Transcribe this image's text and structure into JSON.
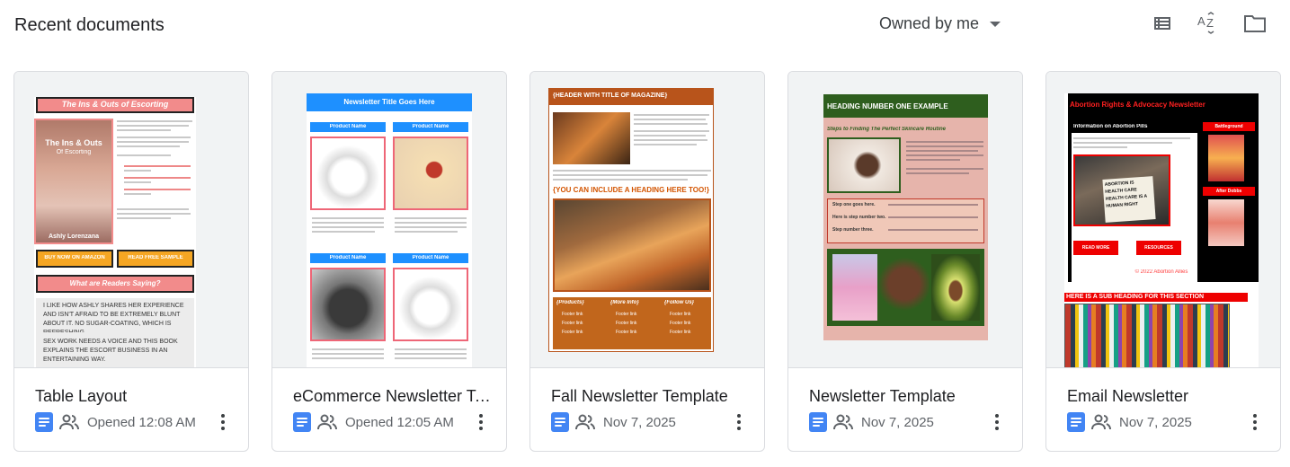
{
  "header": {
    "title": "Recent documents",
    "owner_filter": "Owned by me"
  },
  "toolbar": {
    "list_view_icon": "list-view-icon",
    "sort_icon": "sort-az-icon",
    "folder_icon": "folder-icon"
  },
  "colors": {
    "doc_blue": "#4285f4",
    "border": "#dadce0",
    "meta_gray": "#5f6368"
  },
  "documents": [
    {
      "title": "Table Layout",
      "meta": "Opened 12:08 AM",
      "thumb": {
        "title": "The Ins & Outs of Escorting",
        "book_title": "The Ins & Outs",
        "book_subtitle": "Of Escorting",
        "author": "Ashly Lorenzana",
        "btn1": "BUY NOW ON AMAZON",
        "btn2": "READ FREE SAMPLE",
        "section": "What are Readers Saying?",
        "quote1": "I LIKE HOW ASHLY SHARES HER EXPERIENCE AND ISN'T AFRAID TO BE EXTREMELY BLUNT ABOUT IT. NO SUGAR-COATING, WHICH IS REFRESHING.",
        "quote2": "SEX WORK NEEDS A VOICE AND THIS BOOK EXPLAINS THE ESCORT BUSINESS IN AN ENTERTAINING WAY."
      }
    },
    {
      "title": "eCommerce Newsletter Template",
      "meta": "Opened 12:05 AM",
      "thumb": {
        "title": "Newsletter Title Goes Here",
        "product_label": "Product Name"
      }
    },
    {
      "title": "Fall Newsletter Template",
      "meta": "Nov 7, 2025",
      "thumb": {
        "title": "{HEADER WITH TITLE OF MAGAZINE}",
        "subheading": "{YOU CAN INCLUDE A HEADING HERE TOO!}",
        "footer_cols": [
          "{Products}",
          "{More Info}",
          "{Follow Us}"
        ],
        "footer_link": "Footer link"
      }
    },
    {
      "title": "Newsletter Template",
      "meta": "Nov 7, 2025",
      "thumb": {
        "title": "HEADING NUMBER ONE EXAMPLE",
        "subheading": "Steps to Finding The Perfect Skincare Routine",
        "steps": [
          "Step one goes here.",
          "Here is step number two.",
          "Step number three."
        ]
      }
    },
    {
      "title": "Email Newsletter",
      "meta": "Nov 7, 2025",
      "thumb": {
        "title": "Abortion Rights & Advocacy Newsletter",
        "section": "Information on Abortion Pills",
        "side1": "Battleground",
        "side2": "After Dobbs",
        "sign_text": "ABORTION IS HEALTH CARE HEALTH CARE IS A HUMAN RIGHT",
        "btn1": "READ MORE",
        "btn2": "RESOURCES",
        "copyright": "© 2022 Abortion Allies",
        "subheading": "HERE IS A SUB HEADING FOR THIS SECTION"
      }
    }
  ]
}
